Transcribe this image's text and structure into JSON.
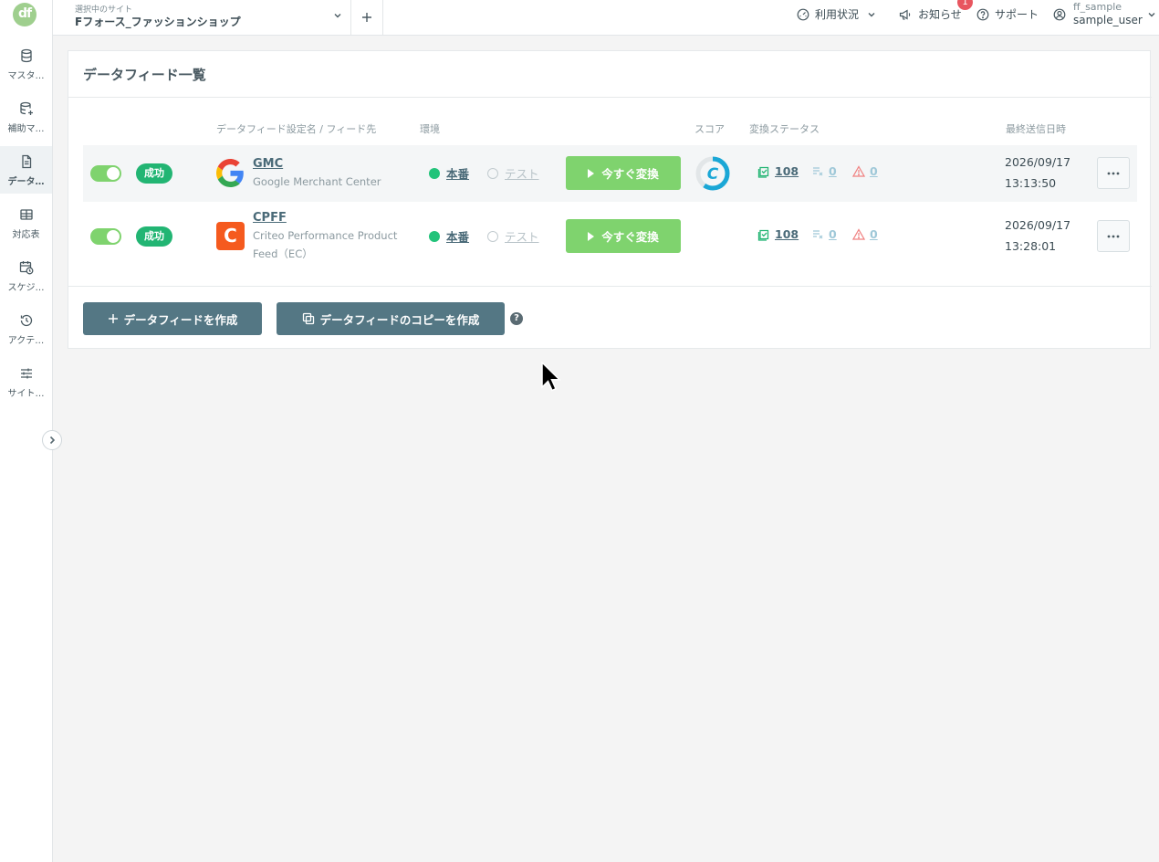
{
  "app": {
    "logo_text": "df"
  },
  "sidebar": {
    "items": [
      {
        "label": "マスタ…",
        "icon": "database-icon"
      },
      {
        "label": "補助マ…",
        "icon": "database-plus-icon"
      },
      {
        "label": "データ…",
        "icon": "document-icon"
      },
      {
        "label": "対応表",
        "icon": "table-icon"
      },
      {
        "label": "スケジ…",
        "icon": "calendar-clock-icon"
      },
      {
        "label": "アクテ…",
        "icon": "history-icon"
      },
      {
        "label": "サイト…",
        "icon": "sliders-icon"
      }
    ],
    "active_index": 2
  },
  "topbar": {
    "site_caption": "選択中のサイト",
    "site_name": "Fフォース_ファッションショップ",
    "usage_label": "利用状況",
    "notice_label": "お知らせ",
    "notice_badge": "1",
    "support_label": "サポート",
    "user_org": "ff_sample",
    "user_name": "sample_user"
  },
  "main": {
    "title": "データフィード一覧",
    "columns": {
      "name": "データフィード設定名 / フィード先",
      "env": "環境",
      "score": "スコア",
      "status": "変換ステータス",
      "sent": "最終送信日時"
    },
    "feeds": [
      {
        "enabled": true,
        "status": "成功",
        "name": "GMC",
        "destination": "Google Merchant Center",
        "logo": "google-logo",
        "env_live": "本番",
        "env_test": "テスト",
        "run_label": "今すぐ変換",
        "score": "C",
        "ok_count": "108",
        "skip_count": "0",
        "warn_count": "0",
        "sent_date": "2026/09/17",
        "sent_time": "13:13:50"
      },
      {
        "enabled": true,
        "status": "成功",
        "name": "CPFF",
        "destination": "Criteo Performance Product Feed（EC）",
        "logo": "criteo-logo",
        "logo_letter": "C",
        "env_live": "本番",
        "env_test": "テスト",
        "run_label": "今すぐ変換",
        "score": "",
        "ok_count": "108",
        "skip_count": "0",
        "warn_count": "0",
        "sent_date": "2026/09/17",
        "sent_time": "13:28:01"
      }
    ],
    "create_label": "データフィードを作成",
    "copy_label": "データフィードのコピーを作成"
  },
  "colors": {
    "accent": "#547784",
    "success": "#22b573",
    "toggle_on": "#7fd36e",
    "run_button": "#7fd36e",
    "score_ring": "#1aa7d6",
    "criteo": "#f55a1e",
    "badge": "#e8565f"
  }
}
